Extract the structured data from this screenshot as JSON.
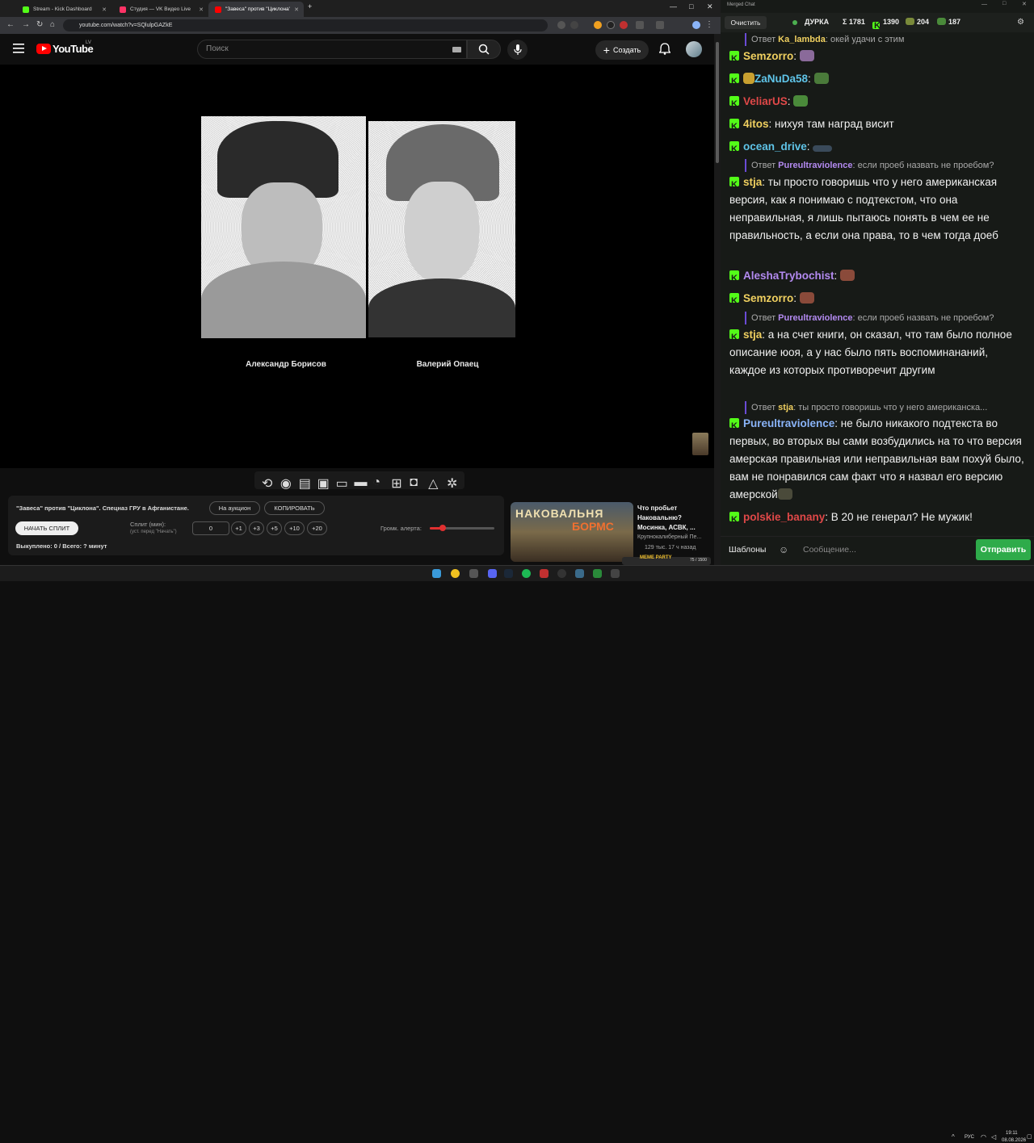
{
  "browser": {
    "tabs": [
      {
        "title": "Stream - Kick Dashboard",
        "color": "#53fc18"
      },
      {
        "title": "Студия — VK Видео Live",
        "color": "#ff3366"
      },
      {
        "title": "\"Завеса\" против \"Циклона\". Спе",
        "color": "#ff0000"
      }
    ],
    "url": "youtube.com/watch?v=SQlulpGAZkE"
  },
  "youtube": {
    "logo": "YouTube",
    "region": "LV",
    "search_placeholder": "Поиск",
    "create_label": "Создать"
  },
  "video": {
    "captions": [
      "Александр Борисов",
      "Валерий Опаец"
    ]
  },
  "panel": {
    "title": "\"Завеса\" против \"Циклона\". Спецназ ГРУ в Афганистане.",
    "auction_label": "На аукцион",
    "copy_label": "КОПИРОВАТЬ",
    "start_split_label": "НАЧАТЬ СПЛИТ",
    "split_label": "Сплит (мин):",
    "split_hint": "(уст. перед \"Начать\")",
    "split_value": "0",
    "increments": [
      "+1",
      "+3",
      "+5",
      "+10",
      "+20"
    ],
    "alert_volume_label": "Громк. алерта:",
    "alert_volume": 0.2,
    "bought_text": "Выкуплено: 0 / Всего: ? минут"
  },
  "recommended": {
    "thumb_text": "НАКОВАЛЬНЯ",
    "thumb_text2": "БОРМС",
    "title": "Что пробьет Наковальню? Мосинка, АСВК, ...",
    "channel": "Крупнокалиберный Пе...",
    "meta": "129 тыс.   17 ч назад"
  },
  "widget": {
    "label": "MEME PARTY",
    "count": "75 / 1500"
  },
  "chat": {
    "window_title": "Merged Chat",
    "clear_label": "Очистить",
    "stats": {
      "durka": "ДУРКА",
      "total": "Σ 1781",
      "kick": "1390",
      "s2": "204",
      "s3": "187"
    },
    "messages": [
      {
        "type": "reply",
        "prefix": "Ответ",
        "nick": "Ka_lambda",
        "text": ": окей  удачи с этим"
      },
      {
        "nick": "Semzorro",
        "color": "#f0d060",
        "text": ":",
        "emote": "#8a6a9a"
      },
      {
        "nick": "ZaNuDa58",
        "color": "#5fc4e8",
        "text": ":",
        "emote": "#4a7a3a"
      },
      {
        "nick": "VeliarUS",
        "color": "#e04848",
        "text": ":",
        "emote": "#4a8a3a"
      },
      {
        "nick": "4itos",
        "color": "#f0d060",
        "text": ": нихуя там наград висит"
      },
      {
        "nick": "ocean_drive",
        "color": "#5fc4e8",
        "text": ":",
        "emote": "#3a4a5a"
      },
      {
        "type": "reply",
        "prefix": "Ответ",
        "nick": "Pureultraviolence",
        "text": ": если проеб назвать не проебом?"
      },
      {
        "nick": "stja",
        "color": "#f0d060",
        "text": ": ты просто говоришь что у него американская версия, как я понимаю с подтекстом, что она неправильная, я лишь пытаюсь понять в чем ее не правильность, а если она права, то в чем тогда доеб"
      },
      {
        "nick": "AleshaTrybochist",
        "color": "#b38af0",
        "text": ":",
        "emote": "#8a4a3a"
      },
      {
        "nick": "Semzorro",
        "color": "#f0d060",
        "text": ":",
        "emote": "#8a4a3a"
      },
      {
        "type": "reply",
        "prefix": "Ответ",
        "nick": "Pureultraviolence",
        "text": ": если проеб назвать не проебом?"
      },
      {
        "nick": "stja",
        "color": "#f0d060",
        "text": ": а на счет книги, он сказал, что там было полное описание юоя, а у нас было пять воспоминананий, каждое из которых противоречит другим"
      },
      {
        "type": "reply",
        "prefix": "Ответ",
        "nick": "stja",
        "text": ": ты просто говоришь что у него американска..."
      },
      {
        "nick": "Pureultraviolence",
        "color": "#8ab4f8",
        "text": ": не было никакого подтекста во первых, во вторых вы сами возбудились на то что версия амерская правильная или неправильная вам похуй было, вам не понравился сам факт что я назвал его версию амерской"
      },
      {
        "nick": "polskie_banany",
        "color": "#e04848",
        "text": ": В 20 не генерал? Не мужик!"
      }
    ],
    "templates_label": "Шаблоны",
    "input_placeholder": "Сообщение...",
    "send_label": "Отправить"
  },
  "taskbar": {
    "lang": "РУС",
    "time": "19:11",
    "date": "08.08.2026"
  }
}
